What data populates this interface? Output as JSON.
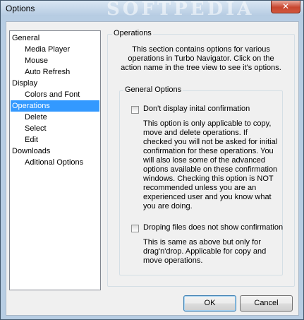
{
  "window": {
    "title": "Options",
    "watermark": "SOFTPEDIA",
    "close_glyph": "✕"
  },
  "tree": {
    "items": [
      {
        "label": "General",
        "level": 0,
        "selected": false
      },
      {
        "label": "Media Player",
        "level": 1,
        "selected": false
      },
      {
        "label": "Mouse",
        "level": 1,
        "selected": false
      },
      {
        "label": "Auto Refresh",
        "level": 1,
        "selected": false
      },
      {
        "label": "Display",
        "level": 0,
        "selected": false
      },
      {
        "label": "Colors and Font",
        "level": 1,
        "selected": false
      },
      {
        "label": "Operations",
        "level": 0,
        "selected": true
      },
      {
        "label": "Delete",
        "level": 1,
        "selected": false
      },
      {
        "label": "Select",
        "level": 1,
        "selected": false
      },
      {
        "label": "Edit",
        "level": 1,
        "selected": false
      },
      {
        "label": "Downloads",
        "level": 0,
        "selected": false
      },
      {
        "label": "Aditional Options",
        "level": 1,
        "selected": false
      }
    ]
  },
  "panel": {
    "title": "Operations",
    "description": [
      "This section contains options for various",
      "operations in Turbo Navigator. Click on the",
      "action name in the tree view to see it's options."
    ],
    "group_title": "General Options",
    "options": [
      {
        "label": "Don't display inital confirmation",
        "checked": false,
        "note": [
          "This option is only applicable to copy,",
          "move and delete operations. If",
          "checked you will not be asked for initial",
          "confirmation for these operations. You",
          "will also lose some of the advanced",
          "options available on these confirmation",
          "windows. Checking this option is NOT",
          "recommended unless you are an",
          "experienced user and you know what",
          "you are doing."
        ]
      },
      {
        "label": "Droping files does not show confirmation",
        "checked": false,
        "note": [
          "This is same as above but only for",
          "drag'n'drop. Applicable for copy and",
          "move operations."
        ]
      }
    ]
  },
  "buttons": {
    "ok": "OK",
    "cancel": "Cancel"
  },
  "colors": {
    "selection": "#3399ff",
    "frame": "#b7cde3",
    "close": "#c8462f"
  }
}
